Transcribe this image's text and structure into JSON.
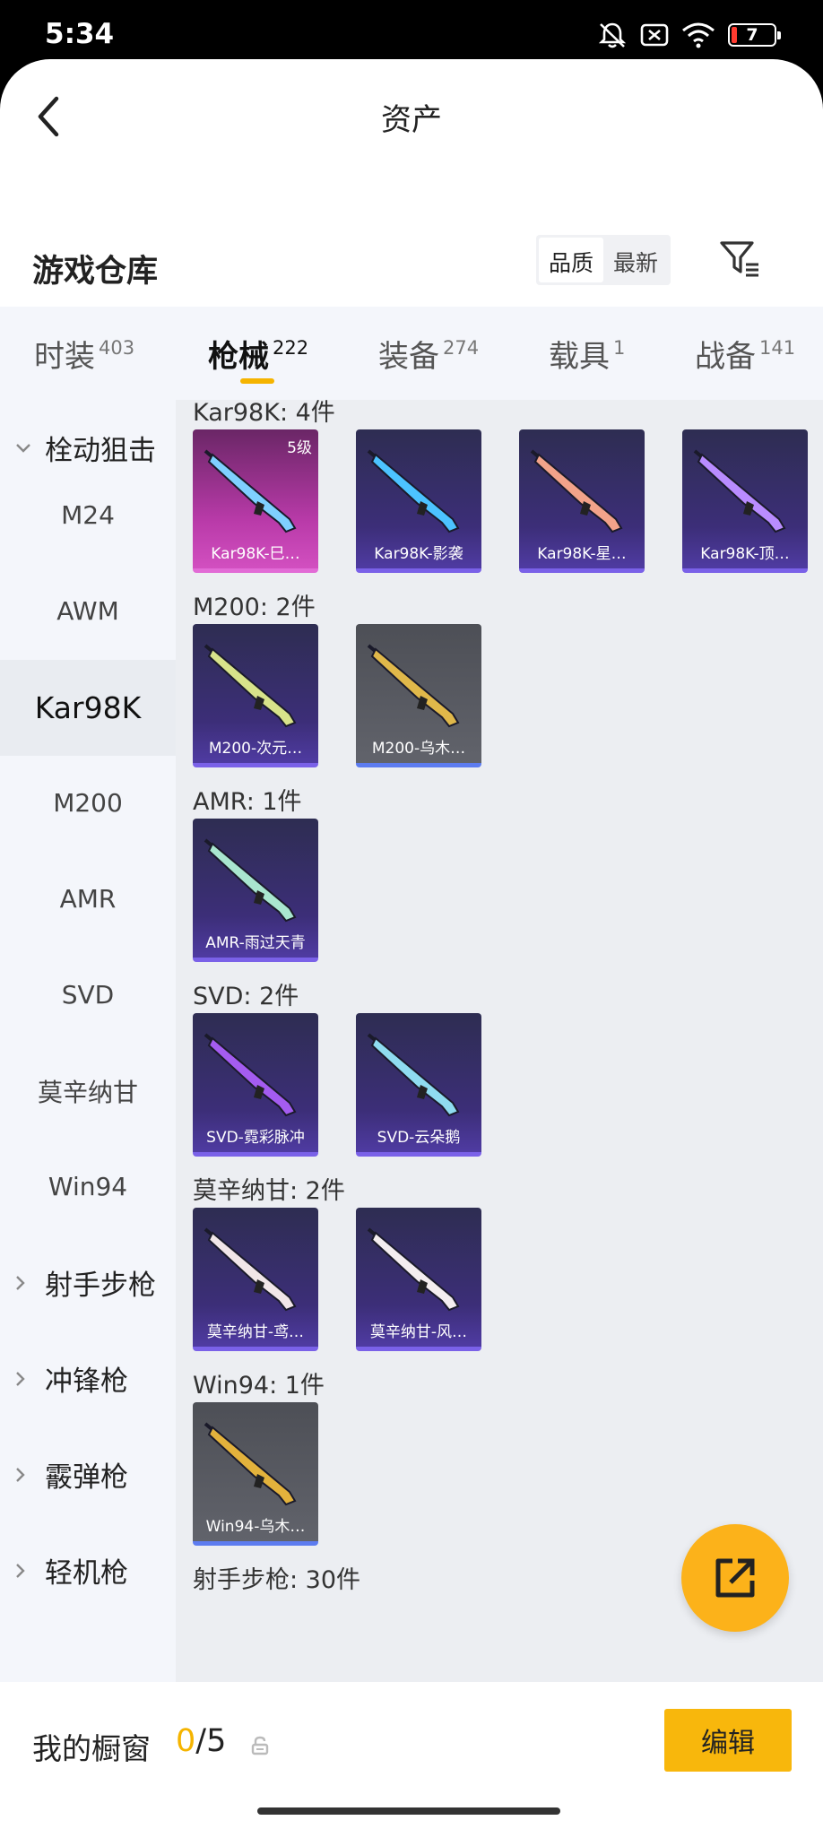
{
  "status": {
    "time": "5:34",
    "battery": "7"
  },
  "header": {
    "title": "资产"
  },
  "warehouse": {
    "title": "游戏仓库",
    "sort_quality": "品质",
    "sort_newest": "最新"
  },
  "tabs": [
    {
      "label": "时装",
      "count": "403"
    },
    {
      "label": "枪械",
      "count": "222"
    },
    {
      "label": "装备",
      "count": "274"
    },
    {
      "label": "载具",
      "count": "1"
    },
    {
      "label": "战备",
      "count": "141"
    }
  ],
  "sidebar": {
    "items": [
      {
        "label": "栓动狙击"
      },
      {
        "label": "M24"
      },
      {
        "label": "AWM"
      },
      {
        "label": "Kar98K"
      },
      {
        "label": "M200"
      },
      {
        "label": "AMR"
      },
      {
        "label": "SVD"
      },
      {
        "label": "莫辛纳甘"
      },
      {
        "label": "Win94"
      },
      {
        "label": "射手步枪"
      },
      {
        "label": "冲锋枪"
      },
      {
        "label": "霰弹枪"
      },
      {
        "label": "轻机枪"
      }
    ]
  },
  "sections": [
    {
      "title": "Kar98K: 4件",
      "items": [
        {
          "name": "Kar98K-巳…",
          "level": "5级",
          "tier": "pink",
          "accent": "#7fd0ff"
        },
        {
          "name": "Kar98K-影袭",
          "tier": "purple",
          "accent": "#4cc3ff"
        },
        {
          "name": "Kar98K-星…",
          "tier": "purple",
          "accent": "#f2a38a"
        },
        {
          "name": "Kar98K-顶…",
          "tier": "purple",
          "accent": "#b98cff"
        }
      ]
    },
    {
      "title": "M200: 2件",
      "items": [
        {
          "name": "M200-次元…",
          "tier": "purple",
          "accent": "#d8e38a"
        },
        {
          "name": "M200-乌木…",
          "tier": "gray",
          "accent": "#e0b84a"
        }
      ]
    },
    {
      "title": "AMR: 1件",
      "items": [
        {
          "name": "AMR-雨过天青",
          "tier": "purple",
          "accent": "#a9e6cf"
        }
      ]
    },
    {
      "title": "SVD: 2件",
      "items": [
        {
          "name": "SVD-霓彩脉冲",
          "tier": "purple",
          "accent": "#a45cf0"
        },
        {
          "name": "SVD-云朵鹅",
          "tier": "purple",
          "accent": "#8fdcf0"
        }
      ]
    },
    {
      "title": "莫辛纳甘: 2件",
      "items": [
        {
          "name": "莫辛纳甘-鸢…",
          "tier": "purple",
          "accent": "#f1e6e8"
        },
        {
          "name": "莫辛纳甘-风…",
          "tier": "purple",
          "accent": "#f4eef0"
        }
      ]
    },
    {
      "title": "Win94: 1件",
      "items": [
        {
          "name": "Win94-乌木…",
          "tier": "gray",
          "accent": "#e3b23c"
        }
      ]
    },
    {
      "title": "射手步枪: 30件",
      "items": []
    }
  ],
  "bottom": {
    "label": "我的橱窗",
    "current": "0",
    "total": "/5",
    "edit": "编辑"
  }
}
